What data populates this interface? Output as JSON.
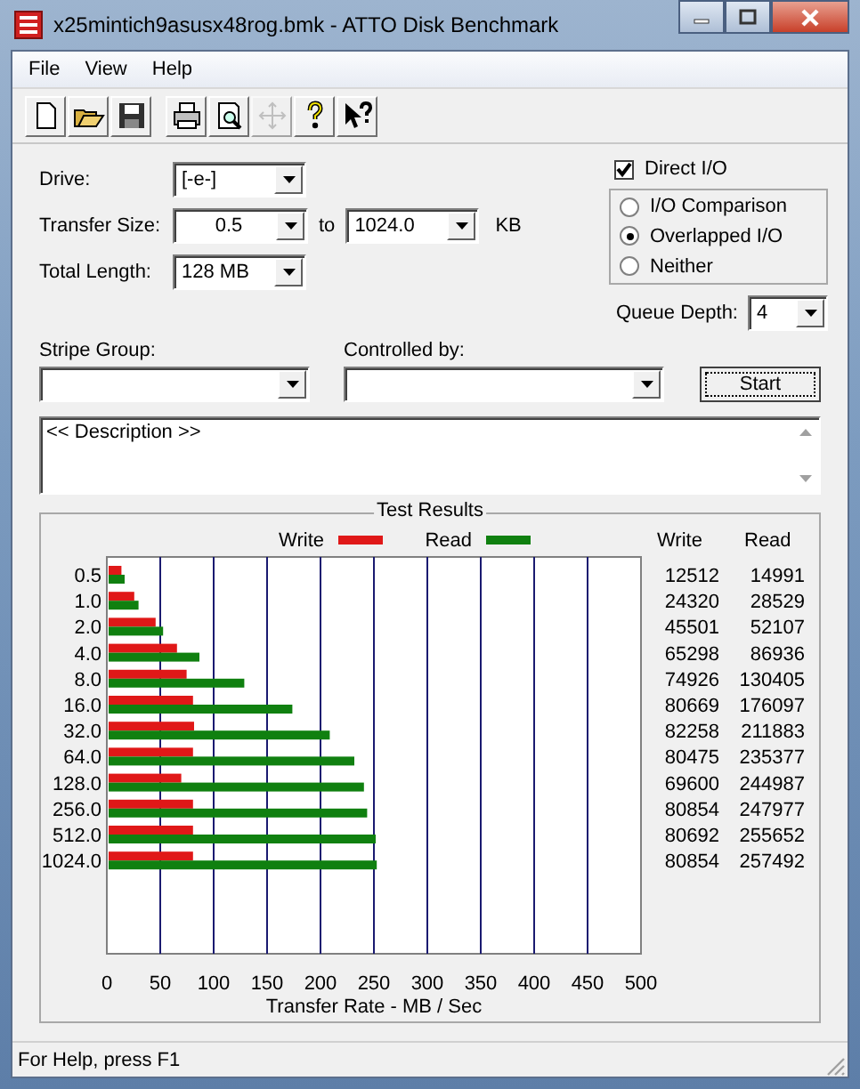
{
  "window": {
    "title": "x25mintich9asusx48rog.bmk - ATTO Disk Benchmark"
  },
  "menu": [
    "File",
    "View",
    "Help"
  ],
  "toolbar": [
    {
      "kind": "new",
      "disabled": false
    },
    {
      "kind": "open",
      "disabled": false
    },
    {
      "kind": "save",
      "disabled": false
    },
    {
      "kind": "print",
      "disabled": false
    },
    {
      "kind": "preview",
      "disabled": false
    },
    {
      "kind": "move",
      "disabled": true
    },
    {
      "kind": "help",
      "disabled": false
    },
    {
      "kind": "context-help",
      "disabled": false
    }
  ],
  "settings": {
    "drive": {
      "label": "Drive:",
      "value": "[-e-]"
    },
    "transfer_size": {
      "label": "Transfer Size:",
      "from": "0.5",
      "to_label": "to",
      "to": "1024.0",
      "unit": "KB"
    },
    "total_length": {
      "label": "Total Length:",
      "value": "128 MB"
    },
    "direct_io": {
      "label": "Direct I/O",
      "checked": true
    },
    "io_modes": [
      {
        "label": "I/O Comparison",
        "selected": false
      },
      {
        "label": "Overlapped I/O",
        "selected": true
      },
      {
        "label": "Neither",
        "selected": false
      }
    ],
    "queue_depth": {
      "label": "Queue Depth:",
      "value": "4"
    },
    "stripe_group": {
      "label": "Stripe Group:"
    },
    "controlled_by": {
      "label": "Controlled by:"
    }
  },
  "start_button": "Start",
  "description": "<< Description >>",
  "results": {
    "title": "Test Results",
    "columns": [
      "Write",
      "Read"
    ],
    "rows": [
      {
        "write": "12512",
        "read": "14991"
      },
      {
        "write": "24320",
        "read": "28529"
      },
      {
        "write": "45501",
        "read": "52107"
      },
      {
        "write": "65298",
        "read": "86936"
      },
      {
        "write": "74926",
        "read": "130405"
      },
      {
        "write": "80669",
        "read": "176097"
      },
      {
        "write": "82258",
        "read": "211883"
      },
      {
        "write": "80475",
        "read": "235377"
      },
      {
        "write": "69600",
        "read": "244987"
      },
      {
        "write": "80854",
        "read": "247977"
      },
      {
        "write": "80692",
        "read": "255652"
      },
      {
        "write": "80854",
        "read": "257492"
      }
    ],
    "chart_data": {
      "type": "bar",
      "orientation": "horizontal",
      "xlabel": "Transfer Rate - MB / Sec",
      "categories": [
        "0.5",
        "1.0",
        "2.0",
        "4.0",
        "8.0",
        "16.0",
        "32.0",
        "64.0",
        "128.0",
        "256.0",
        "512.0",
        "1024.0"
      ],
      "series": [
        {
          "name": "Write",
          "color": "#e01818",
          "values": [
            12,
            24,
            44,
            64,
            73,
            79,
            80,
            79,
            68,
            79,
            79,
            79
          ]
        },
        {
          "name": "Read",
          "color": "#108010",
          "values": [
            15,
            28,
            51,
            85,
            127,
            172,
            207,
            230,
            239,
            242,
            250,
            251
          ]
        }
      ],
      "xlim": [
        0,
        500
      ],
      "xticks": [
        0,
        50,
        100,
        150,
        200,
        250,
        300,
        350,
        400,
        450,
        500
      ],
      "grid": true,
      "legend": true
    }
  },
  "status_bar": "For Help, press F1"
}
